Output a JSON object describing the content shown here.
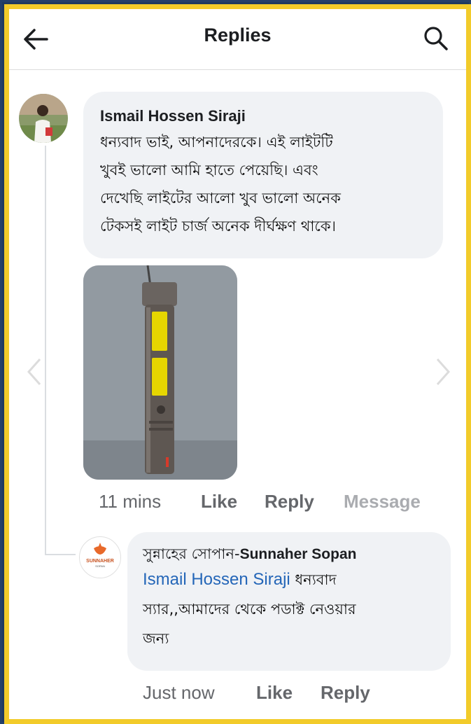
{
  "header": {
    "title": "Replies",
    "back_icon": "arrow-left-icon",
    "search_icon": "search-icon"
  },
  "comment": {
    "author": "Ismail Hossen Siraji",
    "lines": [
      "ধন্যবাদ ভাই, আপনাদেরকে। এই লাইটটি",
      "খুবই ভালো আমি হাতে পেয়েছি। এবং",
      "দেখেছি লাইটের আলো খুব ভালো অনেক",
      "টেকসই লাইট চার্জ অনেক দীর্ঘক্ষণ থাকে।"
    ],
    "photo": "flashlight-photo",
    "time": "11 mins",
    "like_label": "Like",
    "reply_label": "Reply",
    "message_label": "Message"
  },
  "reply": {
    "author_bn": "সুন্নাহের সোপান-",
    "author_en": "Sunnaher Sopan",
    "logo_text": "SUNNAHER",
    "logo_sub": "SOPAN",
    "mention": "Ismail Hossen Siraji",
    "text_first": " ধন্যবাদ",
    "text_lines": [
      "স্যার,,আমাদের থেকে পডাক্ট নেওয়ার",
      "জন্য"
    ],
    "time": "Just now",
    "like_label": "Like",
    "reply_label": "Reply"
  },
  "colors": {
    "frame_border": "#f2cb2a",
    "bubble_bg": "#f0f2f5",
    "mention": "#2466b8",
    "meta_text": "#65676b"
  }
}
